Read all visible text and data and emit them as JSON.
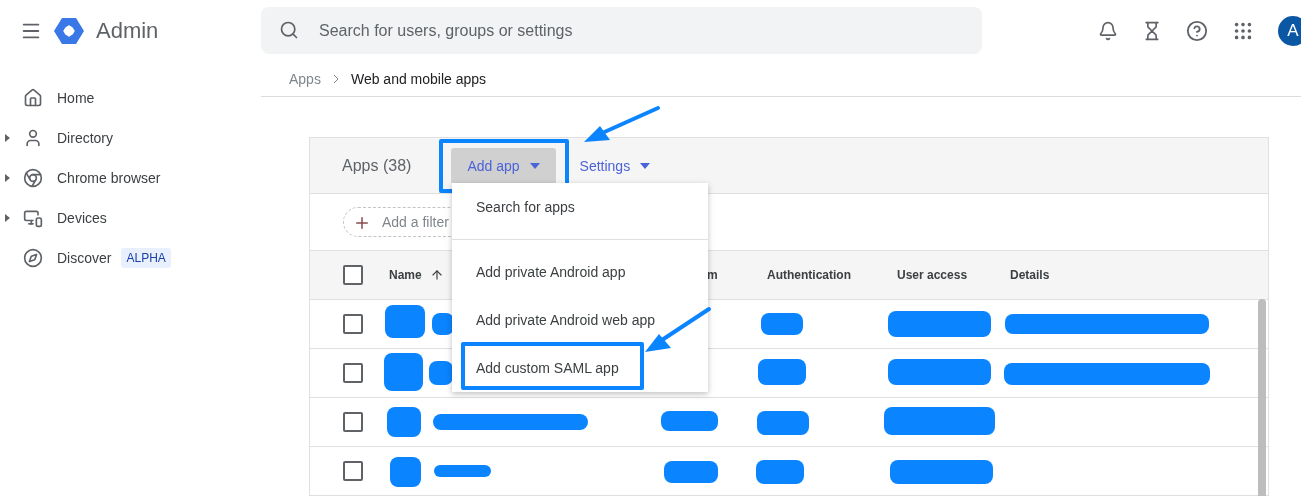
{
  "app": {
    "title": "Admin"
  },
  "search": {
    "placeholder": "Search for users, groups or settings"
  },
  "account": {
    "initial": "A"
  },
  "sidebar": {
    "items": [
      {
        "label": "Home",
        "expandable": false
      },
      {
        "label": "Directory",
        "expandable": true
      },
      {
        "label": "Chrome browser",
        "expandable": true
      },
      {
        "label": "Devices",
        "expandable": true
      },
      {
        "label": "Discover",
        "expandable": false,
        "badge": "ALPHA"
      }
    ]
  },
  "breadcrumb": [
    "Apps",
    "Web and mobile apps"
  ],
  "apps_panel": {
    "title": "Apps (38)",
    "toolbar": [
      {
        "label": "Add app",
        "open": true,
        "highlighted": true
      },
      {
        "label": "Settings",
        "open": false,
        "highlighted": false
      }
    ],
    "filter": {
      "placeholder": "Add a filter"
    },
    "menu": {
      "items": [
        {
          "label": "Search for apps",
          "highlighted": false
        },
        {
          "label": "Add private Android app",
          "highlighted": false
        },
        {
          "label": "Add private Android web app",
          "highlighted": false
        },
        {
          "label": "Add custom SAML app",
          "highlighted": true
        }
      ]
    },
    "table": {
      "all_checked": false,
      "columns": [
        {
          "label": "Name",
          "sorted": true
        },
        {
          "label": "m",
          "sorted": false
        },
        {
          "label": "Authentication",
          "sorted": false
        },
        {
          "label": "User access",
          "sorted": false
        },
        {
          "label": "Details",
          "sorted": false
        }
      ],
      "rows": [
        {
          "checked": false
        },
        {
          "checked": false
        },
        {
          "checked": false
        },
        {
          "checked": false
        }
      ]
    }
  }
}
